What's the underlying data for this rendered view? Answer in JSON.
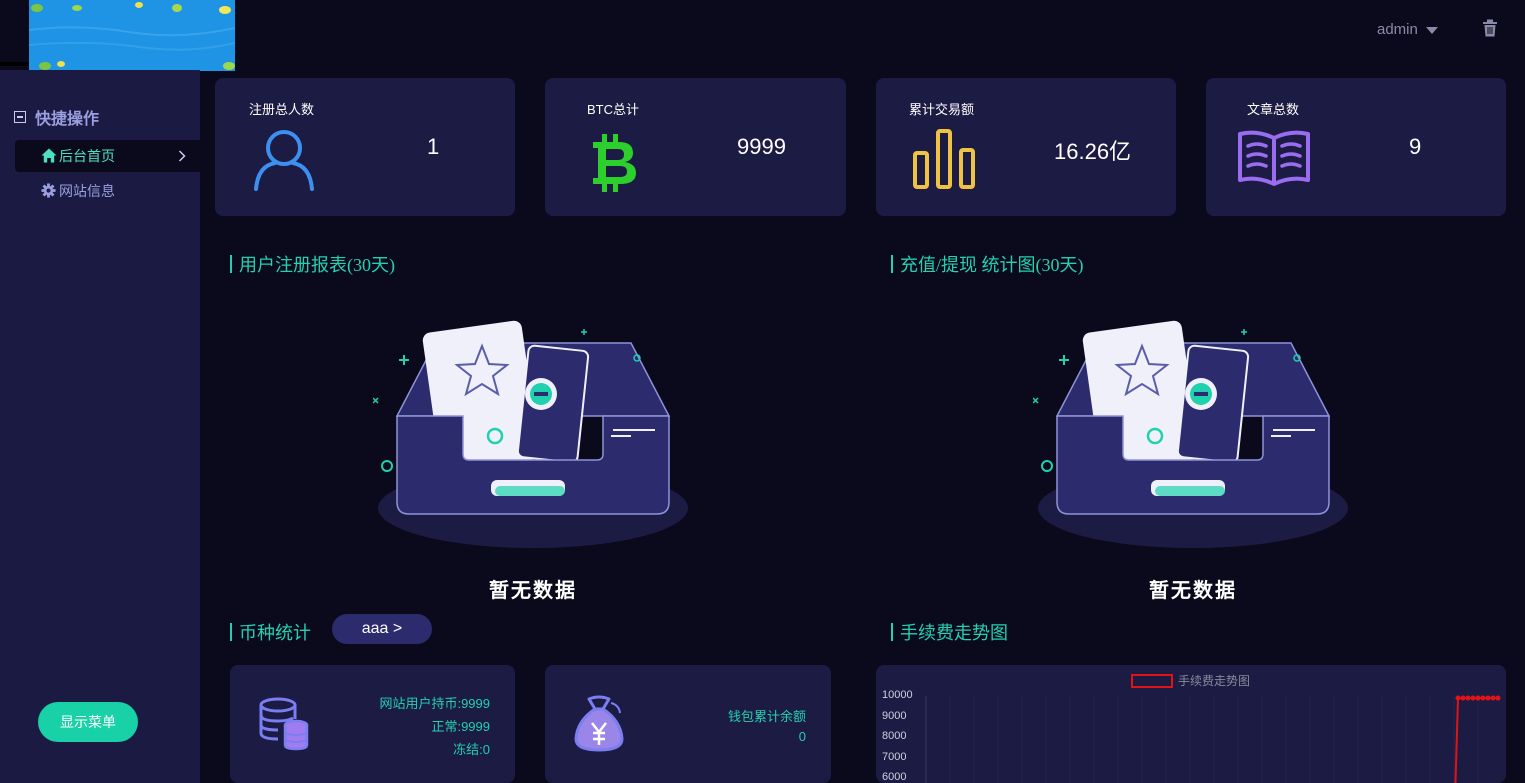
{
  "header": {
    "user_name": "admin"
  },
  "sidebar": {
    "heading": "快捷操作",
    "items": [
      {
        "label": "后台首页",
        "icon": "home-icon",
        "active": true
      },
      {
        "label": "网站信息",
        "icon": "gear-icon",
        "active": false
      }
    ],
    "show_menu_label": "显示菜单"
  },
  "stats": [
    {
      "label": "注册总人数",
      "value": "1",
      "icon": "user-icon",
      "color": "#3d8ff0"
    },
    {
      "label": "BTC总计",
      "value": "9999",
      "icon": "bitcoin-icon",
      "color": "#2ccf2c"
    },
    {
      "label": "累计交易额",
      "value": "16.26亿",
      "icon": "bar-chart-icon",
      "color": "#f0c244"
    },
    {
      "label": "文章总数",
      "value": "9",
      "icon": "book-icon",
      "color": "#9a6cf0"
    }
  ],
  "sections": {
    "register_chart_title": "用户注册报表(30天)",
    "recharge_chart_title": "充值/提现 统计图(30天)",
    "coin_stats_title": "币种统计",
    "fee_trend_title": "手续费走势图",
    "empty_text": "暂无数据"
  },
  "coin_selector": {
    "label": "aaa >"
  },
  "coin_card": {
    "icon": "database-icon",
    "holding": "网站用户持币:9999",
    "normal": "正常:9999",
    "frozen": "冻结:0"
  },
  "wallet_card": {
    "icon": "money-bag-icon",
    "label": "钱包累计余额",
    "value": "0"
  },
  "colors": {
    "accent": "#19d1a7",
    "title": "#23d0b0",
    "card_bg": "#1c1b44",
    "page_bg": "#0a0a1c",
    "sidebar_bg": "#1b1a42",
    "series": "#e01414"
  },
  "chart_data": {
    "type": "line",
    "title": "",
    "legend": [
      "手续费走势图"
    ],
    "legend_position": "top-center",
    "y_ticks": [
      "10000",
      "9000",
      "8000",
      "7000",
      "6000"
    ],
    "ylim": [
      6000,
      10000
    ],
    "grid": true,
    "series": [
      {
        "name": "手续费走势图",
        "color": "#e01414",
        "values": [
          5000,
          9900,
          9900,
          9900,
          9900,
          9900,
          9900,
          9900,
          9900,
          9900
        ]
      }
    ]
  }
}
